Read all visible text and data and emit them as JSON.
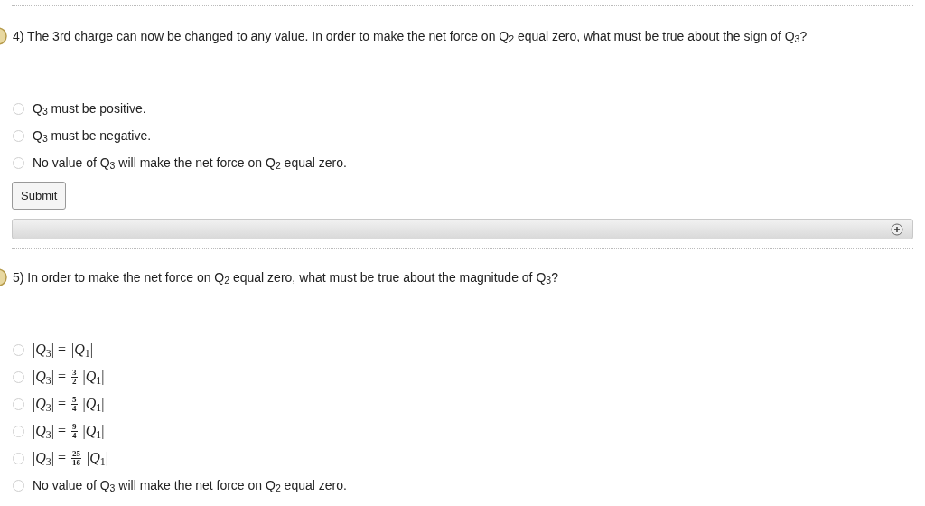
{
  "questions": [
    {
      "prompt": "4) The 3rd charge can now be changed to any value. In order to make the net force on Q$_{2}$ equal zero, what must be true about the sign of Q$_{3}$?",
      "options": [
        {
          "kind": "text",
          "label": "Q$_{3}$ must be positive.",
          "selected": false
        },
        {
          "kind": "text",
          "label": "Q$_{3}$ must be negative.",
          "selected": false
        },
        {
          "kind": "text",
          "label": "No value of Q$_{3}$ will make the net force on Q$_{2}$ equal zero.",
          "selected": false
        }
      ],
      "submit": "Submit",
      "panel": {
        "expanded": false
      }
    },
    {
      "prompt": "5) In order to make the net force on Q$_{2}$ equal zero, what must be true about the magnitude of Q$_{3}$?",
      "options": [
        {
          "kind": "math",
          "lhs": "|*Q*$_{3}$| =",
          "rhs": "|*Q*$_{1}$|",
          "selected": false
        },
        {
          "kind": "math",
          "lhs": "|*Q*$_{3}$| =",
          "numerator": "3",
          "denominator": "2",
          "rhs": "|*Q*$_{1}$|",
          "selected": false
        },
        {
          "kind": "math",
          "lhs": "|*Q*$_{3}$| =",
          "numerator": "5",
          "denominator": "4",
          "rhs": "|*Q*$_{1}$|",
          "selected": false
        },
        {
          "kind": "math",
          "lhs": "|*Q*$_{3}$| =",
          "numerator": "9",
          "denominator": "4",
          "rhs": "|*Q*$_{1}$|",
          "selected": false
        },
        {
          "kind": "math",
          "lhs": "|*Q*$_{3}$| =",
          "numerator": "25",
          "denominator": "16",
          "rhs": "|*Q*$_{1}$|",
          "selected": false
        },
        {
          "kind": "text",
          "label": "No value of Q$_{3}$ will make the net force on Q$_{2}$ equal zero.",
          "selected": false
        }
      ]
    }
  ]
}
